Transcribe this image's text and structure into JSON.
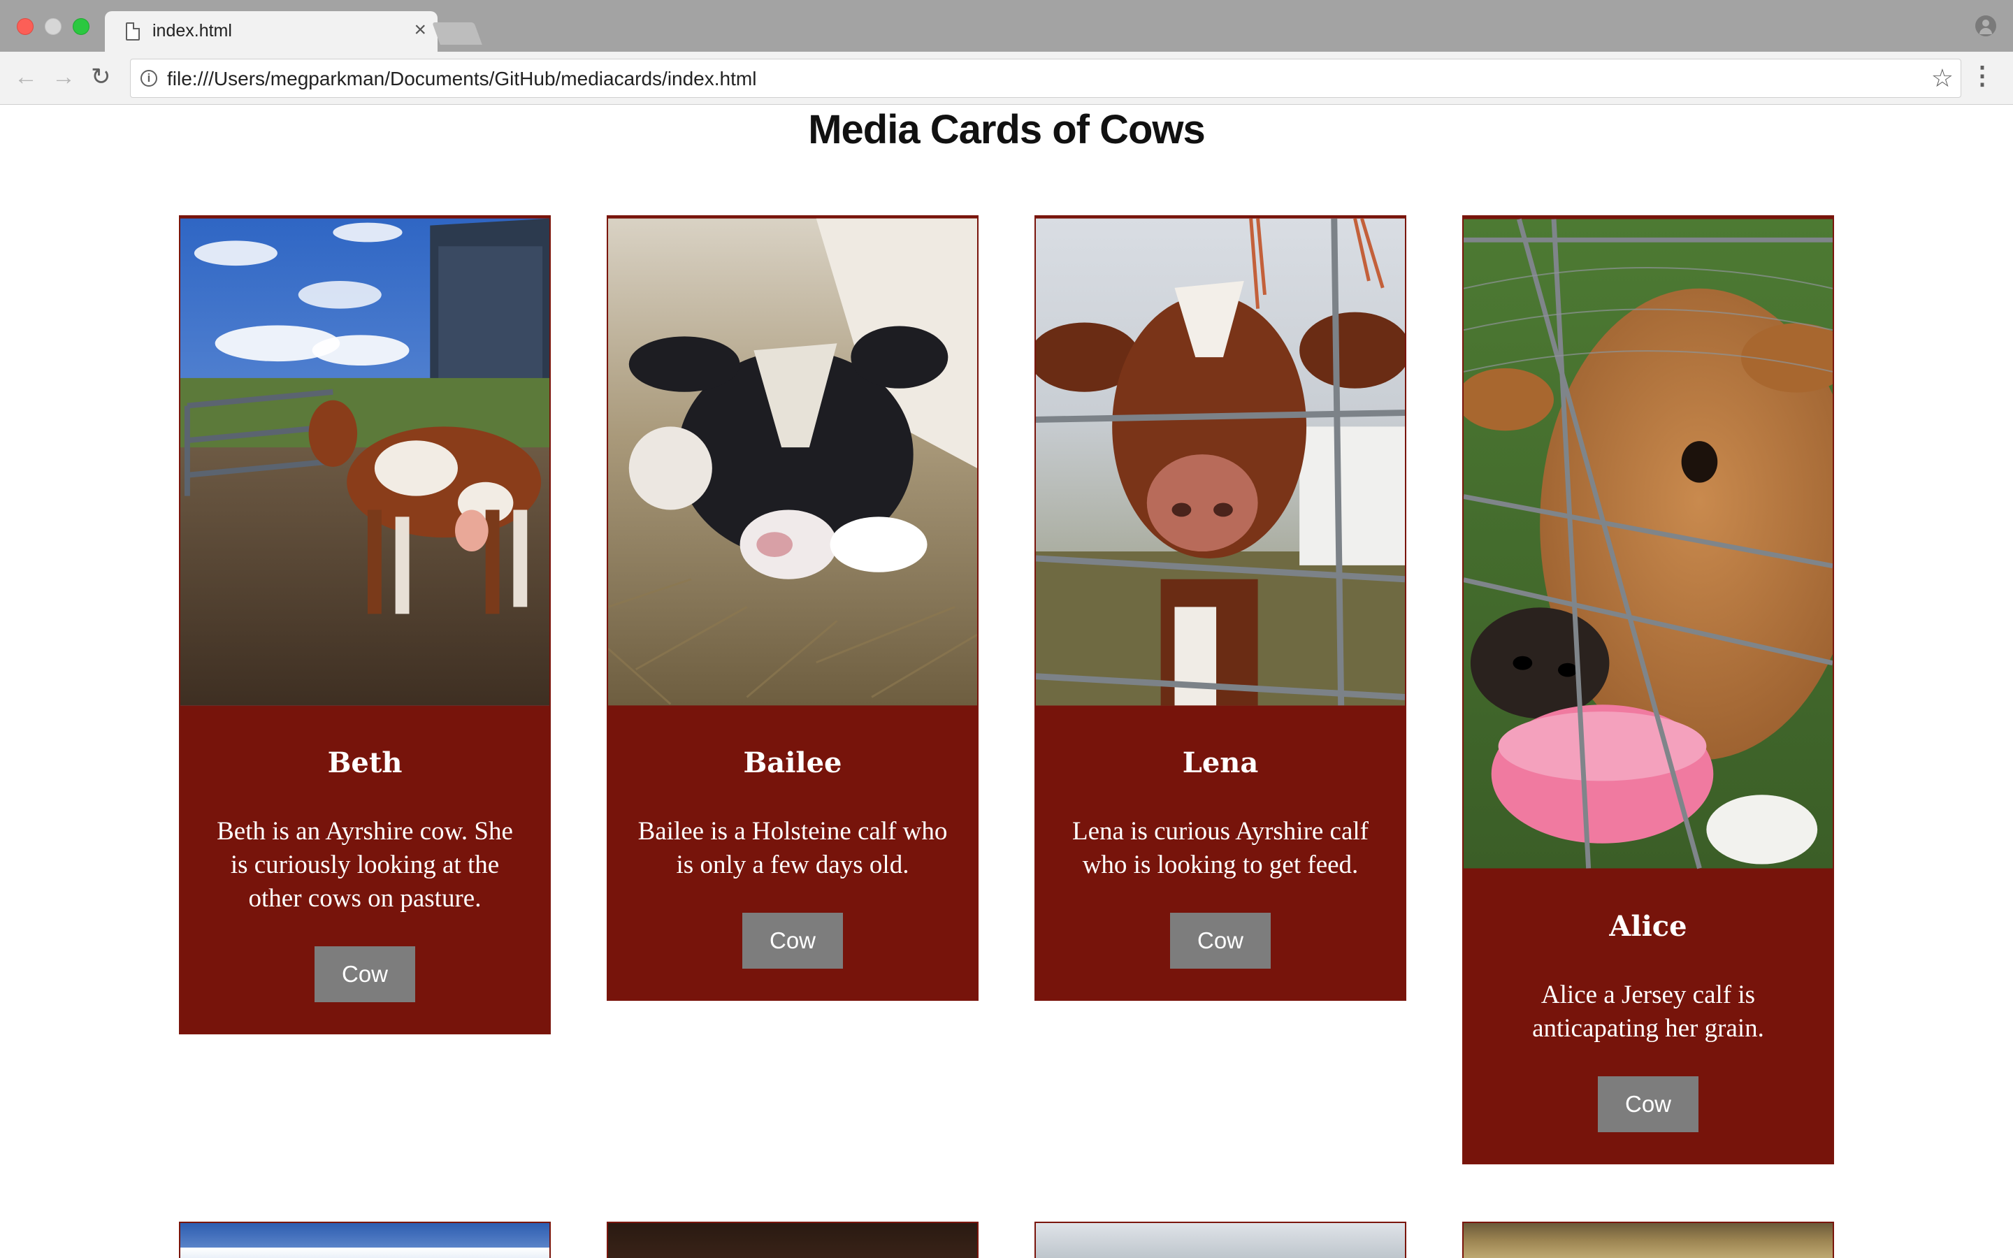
{
  "browser": {
    "tab_title": "index.html",
    "tab_close": "×",
    "url": "file:///Users/megparkman/Documents/GitHub/mediacards/index.html",
    "back_glyph": "←",
    "forward_glyph": "→",
    "reload_glyph": "↻",
    "star_glyph": "☆",
    "menu_glyph": "⋮",
    "info_glyph": "i"
  },
  "page": {
    "title": "Media Cards of Cows"
  },
  "cards": [
    {
      "name": "Beth",
      "description": "Beth is an Ayrshire cow. She is curiously looking at the other cows on pasture.",
      "button": "Cow",
      "photo_desc": "brown-white cow in barnyard"
    },
    {
      "name": "Bailee",
      "description": "Bailee is a Holsteine calf who is only a few days old.",
      "button": "Cow",
      "photo_desc": "black-white calf lying in hay"
    },
    {
      "name": "Lena",
      "description": "Lena is curious Ayrshire calf who is looking to get feed.",
      "button": "Cow",
      "photo_desc": "red-white calf behind gate"
    },
    {
      "name": "Alice",
      "description": "Alice a Jersey calf is anticapating her grain.",
      "button": "Cow",
      "photo_desc": "jersey calf with pink bucket"
    }
  ],
  "colors": {
    "card_bg": "#77140b",
    "button_bg": "#7d7d7d",
    "text_on_card": "#ffffff"
  }
}
